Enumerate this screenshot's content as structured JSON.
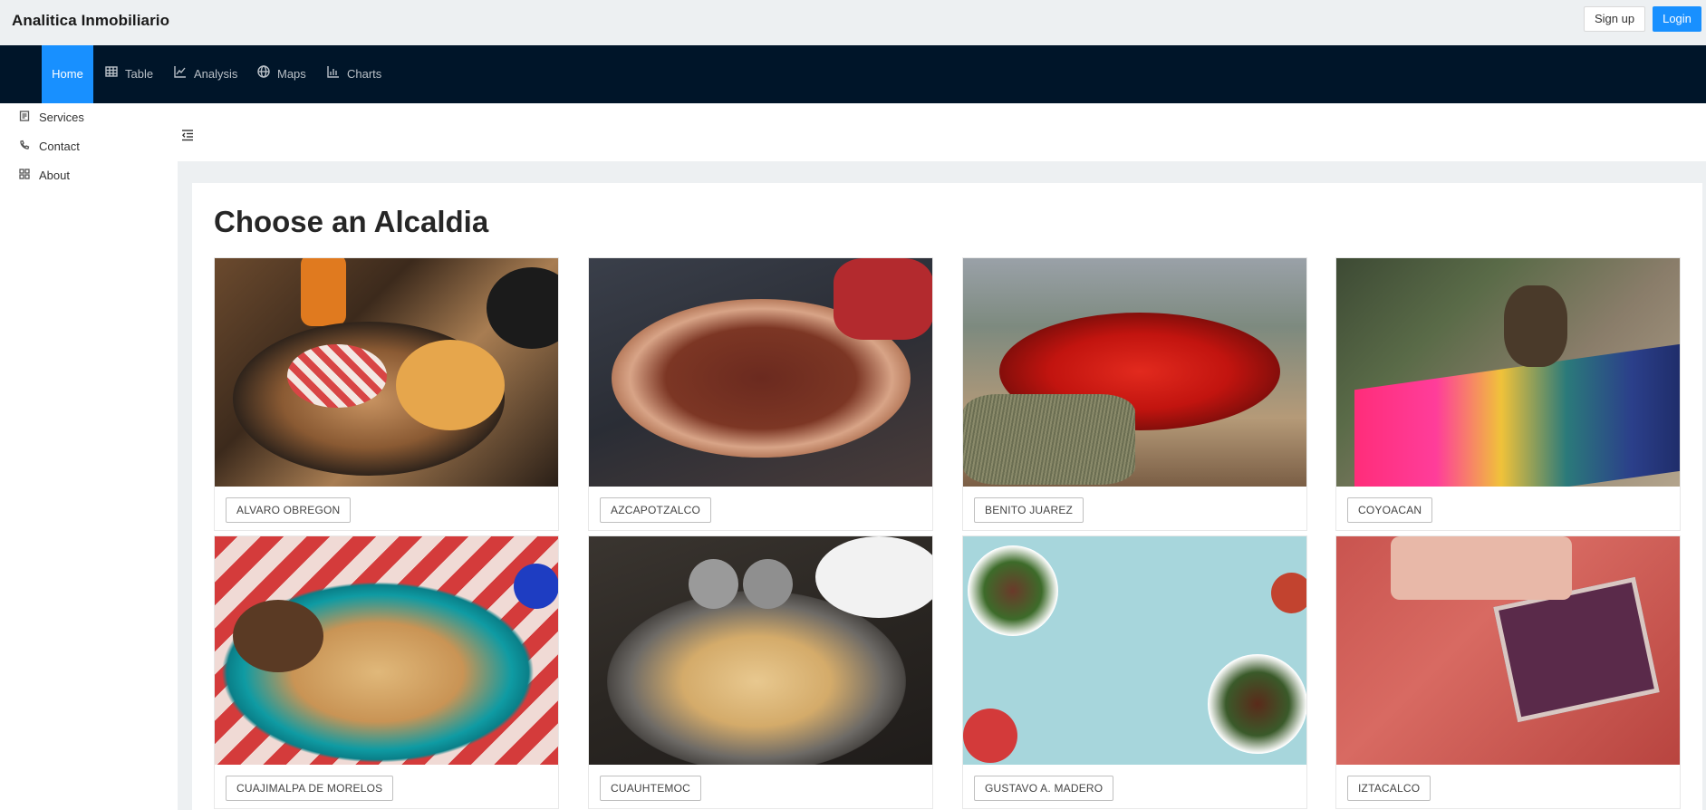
{
  "header": {
    "brand": "Analitica Inmobiliario",
    "signup_label": "Sign up",
    "login_label": "Login"
  },
  "nav": {
    "items": [
      {
        "label": "Home",
        "icon": "home"
      },
      {
        "label": "Table",
        "icon": "table-icon"
      },
      {
        "label": "Analysis",
        "icon": "line-chart-icon"
      },
      {
        "label": "Maps",
        "icon": "globe-icon"
      },
      {
        "label": "Charts",
        "icon": "bar-chart-icon"
      }
    ]
  },
  "sidebar": {
    "items": [
      {
        "label": "Services",
        "icon": "file-list-icon"
      },
      {
        "label": "Contact",
        "icon": "phone-icon"
      },
      {
        "label": "About",
        "icon": "grid-icon"
      }
    ]
  },
  "main": {
    "title": "Choose an Alcaldia",
    "cards": [
      {
        "label": "ALVARO OBREGON"
      },
      {
        "label": "AZCAPOTZALCO"
      },
      {
        "label": "BENITO JUAREZ"
      },
      {
        "label": "COYOACAN"
      },
      {
        "label": "CUAJIMALPA DE MORELOS"
      },
      {
        "label": "CUAUHTEMOC"
      },
      {
        "label": "GUSTAVO A. MADERO"
      },
      {
        "label": "IZTACALCO"
      }
    ]
  },
  "colors": {
    "accent": "#1890ff",
    "nav_bg": "#001529",
    "header_bg": "#edf0f2"
  }
}
